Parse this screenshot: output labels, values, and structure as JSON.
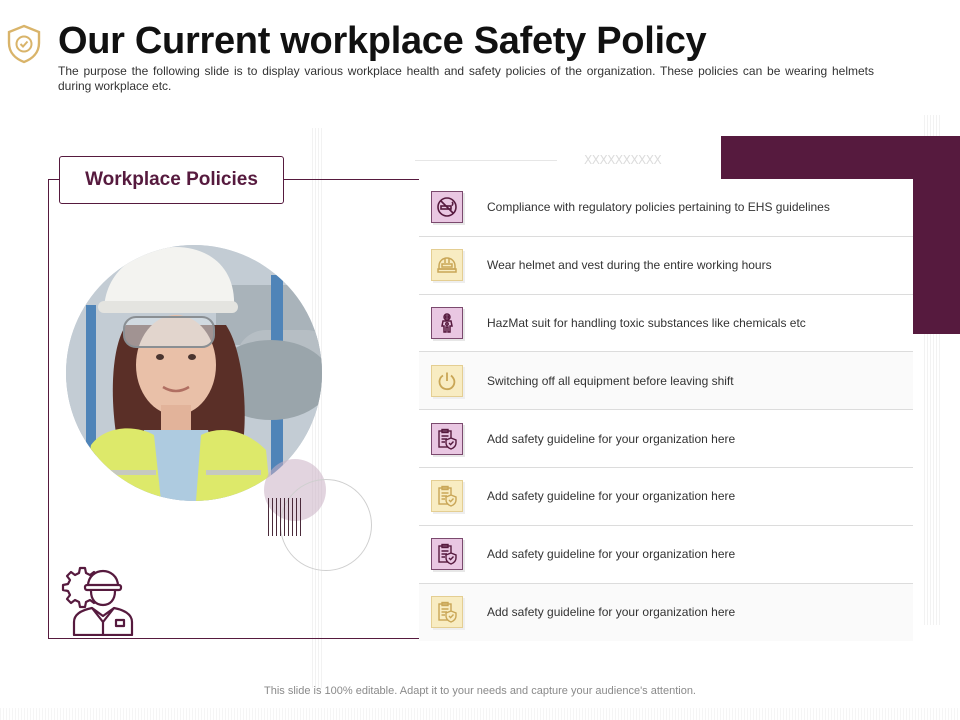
{
  "header": {
    "title": "Our Current workplace Safety Policy",
    "subtitle": "The purpose the following slide is to display various workplace health and safety policies of the organization. These policies can be wearing helmets during workplace etc.",
    "icon": "shield-check-icon"
  },
  "panel": {
    "badge_label": "Workplace Policies",
    "photo": "woman-in-hardhat-photo",
    "corner_icon": "worker-gear-icon"
  },
  "decor": {
    "x_pattern": "XXXXXXXXXX"
  },
  "policies": [
    {
      "text": "Compliance with regulatory policies pertaining to EHS guidelines",
      "icon": "no-smoking-icon",
      "style": "purple"
    },
    {
      "text": "Wear helmet and vest during the entire working hours",
      "icon": "helmet-icon",
      "style": "gold"
    },
    {
      "text": "HazMat suit for handling toxic substances like chemicals etc",
      "icon": "hazmat-suit-icon",
      "style": "purple"
    },
    {
      "text": "Switching off all equipment before leaving shift",
      "icon": "power-icon",
      "style": "gold"
    },
    {
      "text": "Add safety guideline for your organization here",
      "icon": "clipboard-shield-icon",
      "style": "purple"
    },
    {
      "text": "Add safety guideline for your organization here",
      "icon": "clipboard-shield-icon",
      "style": "gold"
    },
    {
      "text": "Add safety guideline for your organization here",
      "icon": "clipboard-shield-icon",
      "style": "purple"
    },
    {
      "text": "Add safety guideline for your organization here",
      "icon": "clipboard-shield-icon",
      "style": "gold"
    }
  ],
  "footer": {
    "note": "This slide is 100% editable. Adapt it to your needs and capture your audience's attention."
  },
  "colors": {
    "accent": "#561a3e",
    "icon_purple_bg": "#e9c7e2",
    "icon_gold_bg": "#f8ecc2",
    "title_icon": "#d9b46a"
  }
}
